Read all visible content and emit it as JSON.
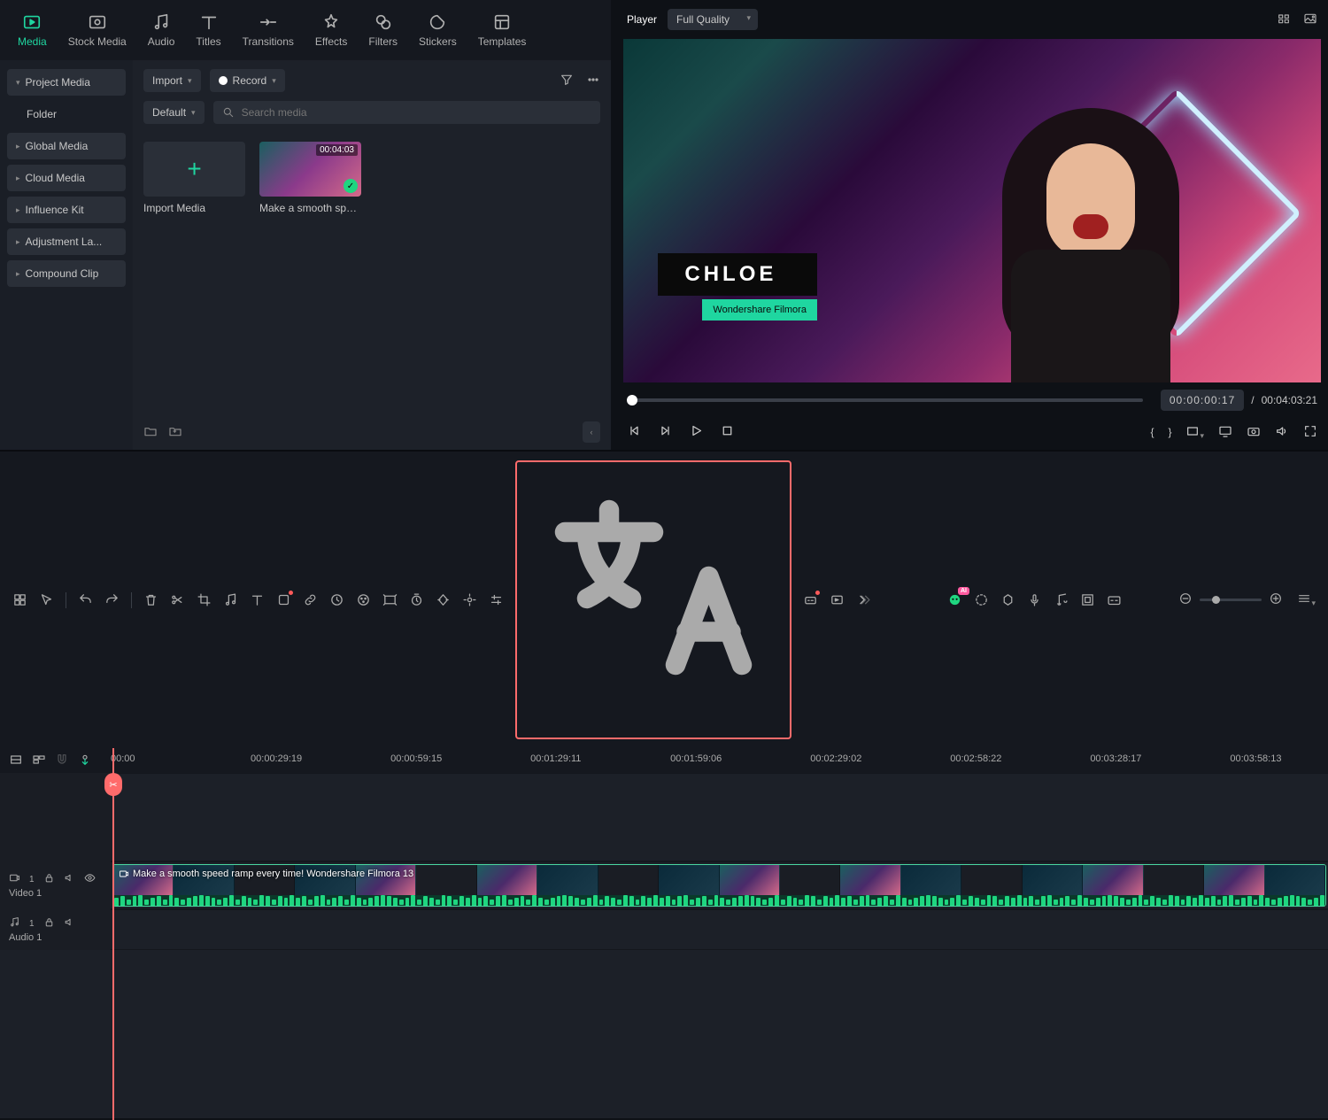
{
  "tabs": [
    "Media",
    "Stock Media",
    "Audio",
    "Titles",
    "Transitions",
    "Effects",
    "Filters",
    "Stickers",
    "Templates"
  ],
  "sidebar": {
    "items": [
      {
        "label": "Project Media",
        "type": "bold"
      },
      {
        "label": "Folder",
        "type": "plain"
      },
      {
        "label": "Global Media",
        "type": "chev"
      },
      {
        "label": "Cloud Media",
        "type": "chev"
      },
      {
        "label": "Influence Kit",
        "type": "chev"
      },
      {
        "label": "Adjustment La...",
        "type": "chev"
      },
      {
        "label": "Compound Clip",
        "type": "chev"
      }
    ]
  },
  "toolbar": {
    "import": "Import",
    "record": "Record",
    "sort": "Default",
    "search_placeholder": "Search media"
  },
  "media": {
    "import_label": "Import Media",
    "clip": {
      "duration": "00:04:03",
      "name": "Make a smooth speed..."
    }
  },
  "player": {
    "tab": "Player",
    "quality": "Full Quality",
    "lower_third_name": "CHLOE",
    "lower_third_sub": "Wondershare Filmora",
    "current_time": "00:00:00:17",
    "total_time": "00:04:03:21"
  },
  "ruler": {
    "ticks": [
      "00:00",
      "00:00:29:19",
      "00:00:59:15",
      "00:01:29:11",
      "00:01:59:06",
      "00:02:29:02",
      "00:02:58:22",
      "00:03:28:17",
      "00:03:58:13"
    ]
  },
  "tracks": {
    "video": {
      "label": "Video 1",
      "clip_label": "Make a smooth speed ramp every time!   Wondershare Filmora 13"
    },
    "audio": {
      "label": "Audio 1"
    }
  }
}
